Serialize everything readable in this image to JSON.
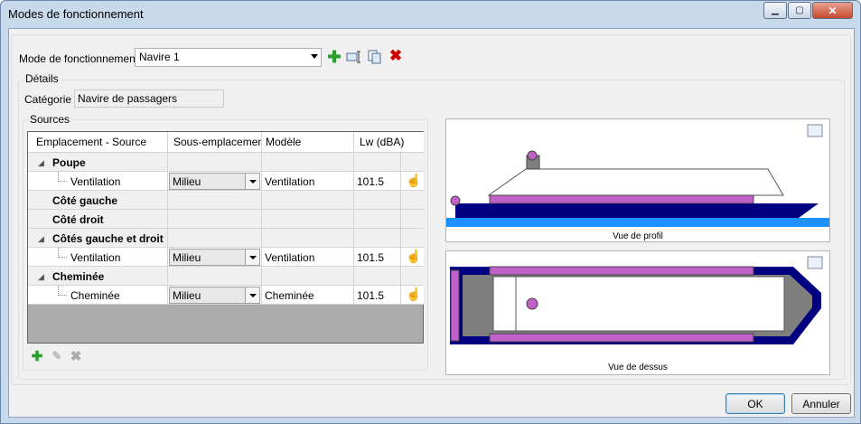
{
  "window": {
    "title": "Modes de fonctionnement"
  },
  "mode": {
    "label": "Mode de fonctionnement",
    "value": "Navire 1"
  },
  "details": {
    "legend": "Détails",
    "category_label": "Catégorie",
    "category_value": "Navire de passagers"
  },
  "sources": {
    "legend": "Sources",
    "columns": [
      "Emplacement - Source",
      "Sous-emplacement",
      "Modèle",
      "Lw (dBA)"
    ],
    "rows": [
      {
        "type": "group",
        "name": "Poupe",
        "expanded": true
      },
      {
        "type": "data",
        "source": "Ventilation",
        "sub": "Milieu",
        "model": "Ventilation",
        "lw": "101.5"
      },
      {
        "type": "group",
        "name": "Côté gauche",
        "expanded": false
      },
      {
        "type": "group",
        "name": "Côté droit",
        "expanded": false
      },
      {
        "type": "group",
        "name": "Côtés gauche et droit",
        "expanded": true
      },
      {
        "type": "data",
        "source": "Ventilation",
        "sub": "Milieu",
        "model": "Ventilation",
        "lw": "101.5"
      },
      {
        "type": "group",
        "name": "Cheminée",
        "expanded": true
      },
      {
        "type": "data",
        "source": "Cheminée",
        "sub": "Milieu",
        "model": "Cheminée",
        "lw": "101.5"
      }
    ]
  },
  "views": {
    "profile_caption": "Vue de profil",
    "top_caption": "Vue de dessus"
  },
  "buttons": {
    "ok": "OK",
    "cancel": "Annuler"
  },
  "colors": {
    "hull": "#000080",
    "water": "#1e90ff",
    "source": "#c060c8",
    "deck_gray": "#7f7f7f"
  }
}
